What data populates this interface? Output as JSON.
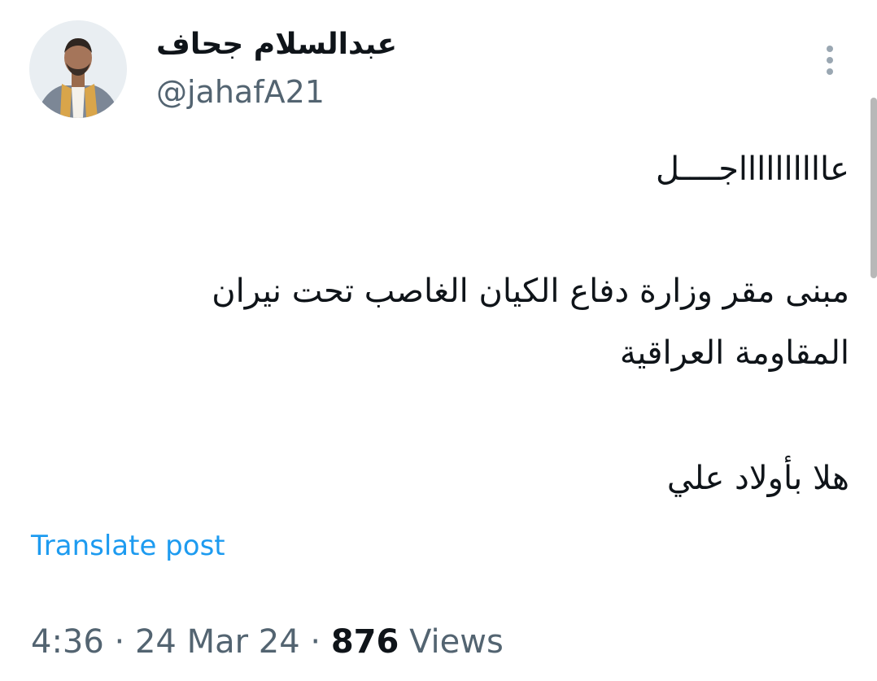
{
  "author": {
    "display_name": "عبدالسلام جحاف",
    "handle": "@jahafA21"
  },
  "tweet": {
    "lines": [
      "عااااااااااجــــل",
      "مبنى مقر وزارة دفاع الكيان الغاصب تحت نيران",
      "المقاومة العراقية",
      "هلا بأولاد علي"
    ]
  },
  "actions": {
    "translate_label": "Translate post",
    "more_icon": "more-vertical-icon"
  },
  "meta": {
    "time": "4:36",
    "separator": " · ",
    "date": "24 Mar 24",
    "views_count": "876",
    "views_label": "Views"
  },
  "colors": {
    "text_primary": "#0f1419",
    "text_secondary": "#536471",
    "link": "#1d9bf0"
  }
}
